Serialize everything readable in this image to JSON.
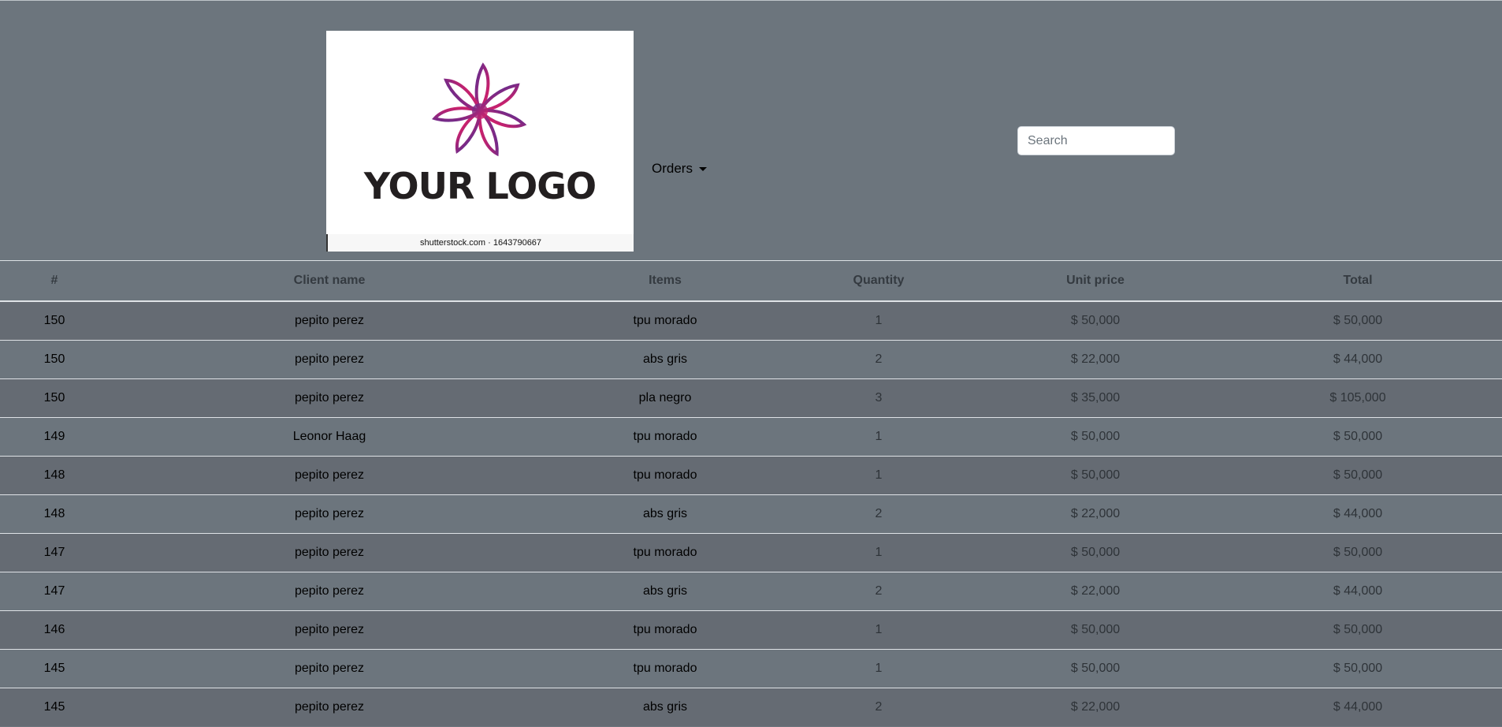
{
  "header": {
    "logo": {
      "text": "YOUR LOGO",
      "credit": "shutterstock.com · 1643790667",
      "icon": "flower-logo-icon"
    },
    "nav": {
      "orders_label": "Orders"
    },
    "search": {
      "placeholder": "Search",
      "value": ""
    }
  },
  "table": {
    "columns": [
      "#",
      "Client name",
      "Items",
      "Quantity",
      "Unit price",
      "Total"
    ],
    "rows": [
      {
        "id": "150",
        "client": "pepito perez",
        "item": "tpu morado",
        "qty": "1",
        "unit": "$ 50,000",
        "total": "$ 50,000"
      },
      {
        "id": "150",
        "client": "pepito perez",
        "item": "abs gris",
        "qty": "2",
        "unit": "$ 22,000",
        "total": "$ 44,000"
      },
      {
        "id": "150",
        "client": "pepito perez",
        "item": "pla negro",
        "qty": "3",
        "unit": "$ 35,000",
        "total": "$ 105,000"
      },
      {
        "id": "149",
        "client": "Leonor Haag",
        "item": "tpu morado",
        "qty": "1",
        "unit": "$ 50,000",
        "total": "$ 50,000"
      },
      {
        "id": "148",
        "client": "pepito perez",
        "item": "tpu morado",
        "qty": "1",
        "unit": "$ 50,000",
        "total": "$ 50,000"
      },
      {
        "id": "148",
        "client": "pepito perez",
        "item": "abs gris",
        "qty": "2",
        "unit": "$ 22,000",
        "total": "$ 44,000"
      },
      {
        "id": "147",
        "client": "pepito perez",
        "item": "tpu morado",
        "qty": "1",
        "unit": "$ 50,000",
        "total": "$ 50,000"
      },
      {
        "id": "147",
        "client": "pepito perez",
        "item": "abs gris",
        "qty": "2",
        "unit": "$ 22,000",
        "total": "$ 44,000"
      },
      {
        "id": "146",
        "client": "pepito perez",
        "item": "tpu morado",
        "qty": "1",
        "unit": "$ 50,000",
        "total": "$ 50,000"
      },
      {
        "id": "145",
        "client": "pepito perez",
        "item": "tpu morado",
        "qty": "1",
        "unit": "$ 50,000",
        "total": "$ 50,000"
      },
      {
        "id": "145",
        "client": "pepito perez",
        "item": "abs gris",
        "qty": "2",
        "unit": "$ 22,000",
        "total": "$ 44,000"
      }
    ]
  },
  "colors": {
    "page_bg": "#6c757d",
    "row_striped": "#656b73",
    "border": "#dee2e6",
    "logo_gradient_start": "#5b2d90",
    "logo_gradient_end": "#e81e63"
  }
}
